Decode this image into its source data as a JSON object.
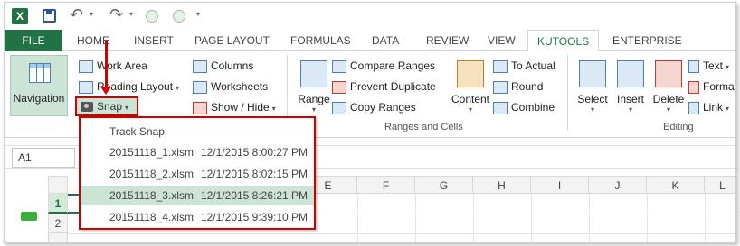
{
  "tabs": {
    "file": "FILE",
    "home": "HOME",
    "insert": "INSERT",
    "page_layout": "PAGE LAYOUT",
    "formulas": "FORMULAS",
    "data": "DATA",
    "review": "REVIEW",
    "view": "VIEW",
    "kutools": "KUTOOLS",
    "enterprise": "ENTERPRISE"
  },
  "ribbon": {
    "navigation": "Navigation",
    "work_area": "Work Area",
    "reading_layout": "Reading Layout",
    "snap": "Snap",
    "columns": "Columns",
    "worksheets": "Worksheets",
    "show_hide": "Show / Hide",
    "range": "Range",
    "compare_ranges": "Compare Ranges",
    "prevent_duplicate": "Prevent Duplicate",
    "copy_ranges": "Copy Ranges",
    "content": "Content",
    "to_actual": "To Actual",
    "round": "Round",
    "combine": "Combine",
    "ranges_and_cells": "Ranges and Cells",
    "select": "Select",
    "insert": "Insert",
    "delete": "Delete",
    "text": "Text",
    "format": "Forma",
    "link": "Link",
    "editing": "Editing"
  },
  "name_box": "A1",
  "columns": [
    "E",
    "F",
    "G",
    "H",
    "I",
    "J",
    "K",
    "L"
  ],
  "rows": [
    "1",
    "2"
  ],
  "snap_menu": {
    "track_snap": "Track Snap",
    "snaps": [
      {
        "file": "20151118_1.xlsm",
        "time": "12/1/2015 8:00:27 PM"
      },
      {
        "file": "20151118_2.xlsm",
        "time": "12/1/2015 8:02:15 PM"
      },
      {
        "file": "20151118_3.xlsm",
        "time": "12/1/2015 8:26:21 PM"
      },
      {
        "file": "20151118_4.xlsm",
        "time": "12/1/2015 9:39:10 PM"
      }
    ]
  },
  "colors": {
    "excel_green": "#217346",
    "highlight": "#cce4d5",
    "callout_red": "#d00000"
  }
}
